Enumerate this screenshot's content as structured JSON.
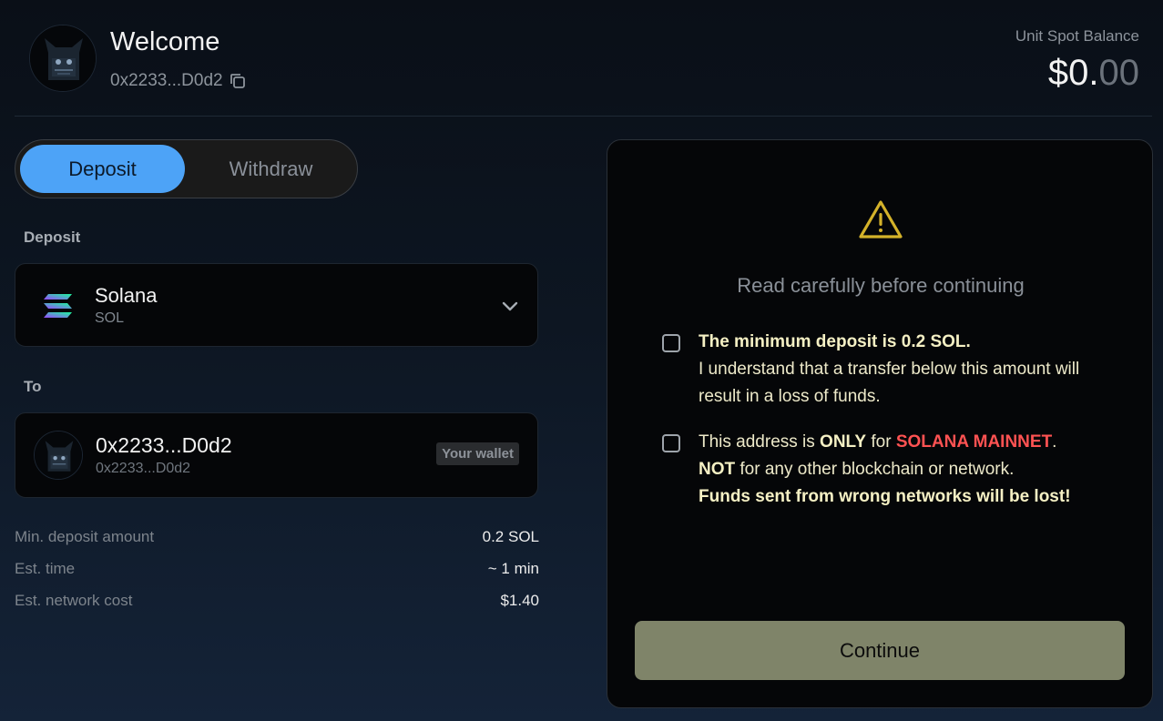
{
  "header": {
    "title": "Welcome",
    "address": "0x2233...D0d2",
    "balance_label": "Unit Spot Balance",
    "balance_int": "$0.",
    "balance_dec": "00"
  },
  "tabs": [
    {
      "label": "Deposit",
      "active": true
    },
    {
      "label": "Withdraw",
      "active": false
    }
  ],
  "deposit_section": {
    "label": "Deposit",
    "asset_name": "Solana",
    "asset_symbol": "SOL"
  },
  "to_section": {
    "label": "To",
    "address": "0x2233...D0d2",
    "address_sub": "0x2233...D0d2",
    "badge": "Your wallet"
  },
  "info": [
    {
      "label": "Min. deposit amount",
      "value": "0.2 SOL"
    },
    {
      "label": "Est. time",
      "value": "~ 1 min"
    },
    {
      "label": "Est. network cost",
      "value": "$1.40"
    }
  ],
  "panel": {
    "title": "Read carefully before continuing",
    "check1_bold": "The minimum deposit is 0.2 SOL.",
    "check1_text": "I understand that a transfer below this amount will result in a loss of funds.",
    "check2_a": "This address is ",
    "check2_only": "ONLY",
    "check2_b": " for ",
    "check2_network": "SOLANA MAINNET",
    "check2_c": ".",
    "check2_not": "NOT",
    "check2_d": " for any other blockchain or network.",
    "check2_bold": "Funds sent from wrong networks will be lost!",
    "continue_label": "Continue"
  },
  "colors": {
    "accent": "#4da3f7",
    "warning": "#d4b22a",
    "danger": "#ff5252",
    "continue_bg": "#7f8469"
  },
  "icons": {
    "copy": "copy-icon",
    "chevron": "chevron-down-icon",
    "warning": "warning-triangle-icon",
    "solana": "solana-logo-icon"
  }
}
